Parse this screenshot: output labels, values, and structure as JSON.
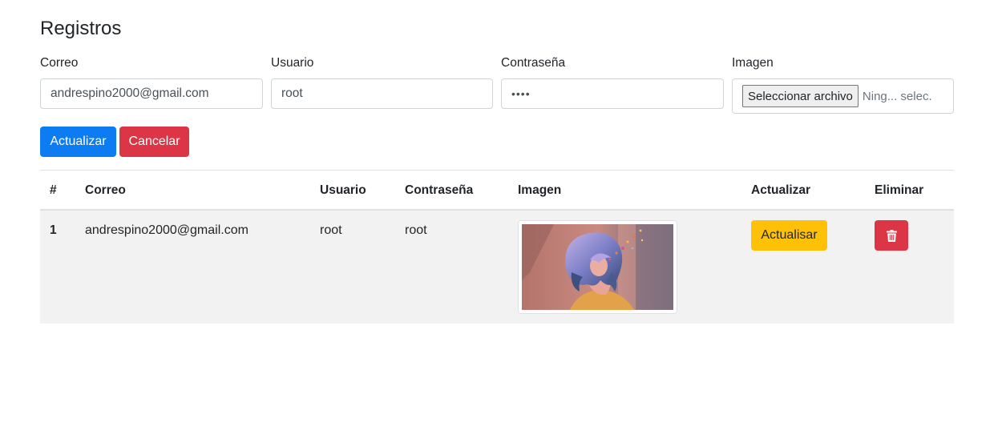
{
  "page": {
    "title": "Registros"
  },
  "form": {
    "email": {
      "label": "Correo",
      "value": "andrespino2000@gmail.com"
    },
    "user": {
      "label": "Usuario",
      "value": "root"
    },
    "password": {
      "label": "Contraseña",
      "masked_value": "••••"
    },
    "image": {
      "label": "Imagen",
      "button_label": "Seleccionar archivo",
      "status": "Ning... selec."
    }
  },
  "actions": {
    "update_label": "Actualizar",
    "cancel_label": "Cancelar"
  },
  "table": {
    "columns": [
      "#",
      "Correo",
      "Usuario",
      "Contraseña",
      "Imagen",
      "Actualizar",
      "Eliminar"
    ],
    "rows": [
      {
        "index": "1",
        "email": "andrespino2000@gmail.com",
        "user": "root",
        "password": "root",
        "image_icon": "portrait-thumbnail",
        "update_label": "Actualisar",
        "delete_icon": "trash-icon"
      }
    ]
  },
  "colors": {
    "primary": "#0d7cf2",
    "danger": "#dc3545",
    "warning": "#ffc107",
    "row_background": "#f2f2f2"
  }
}
